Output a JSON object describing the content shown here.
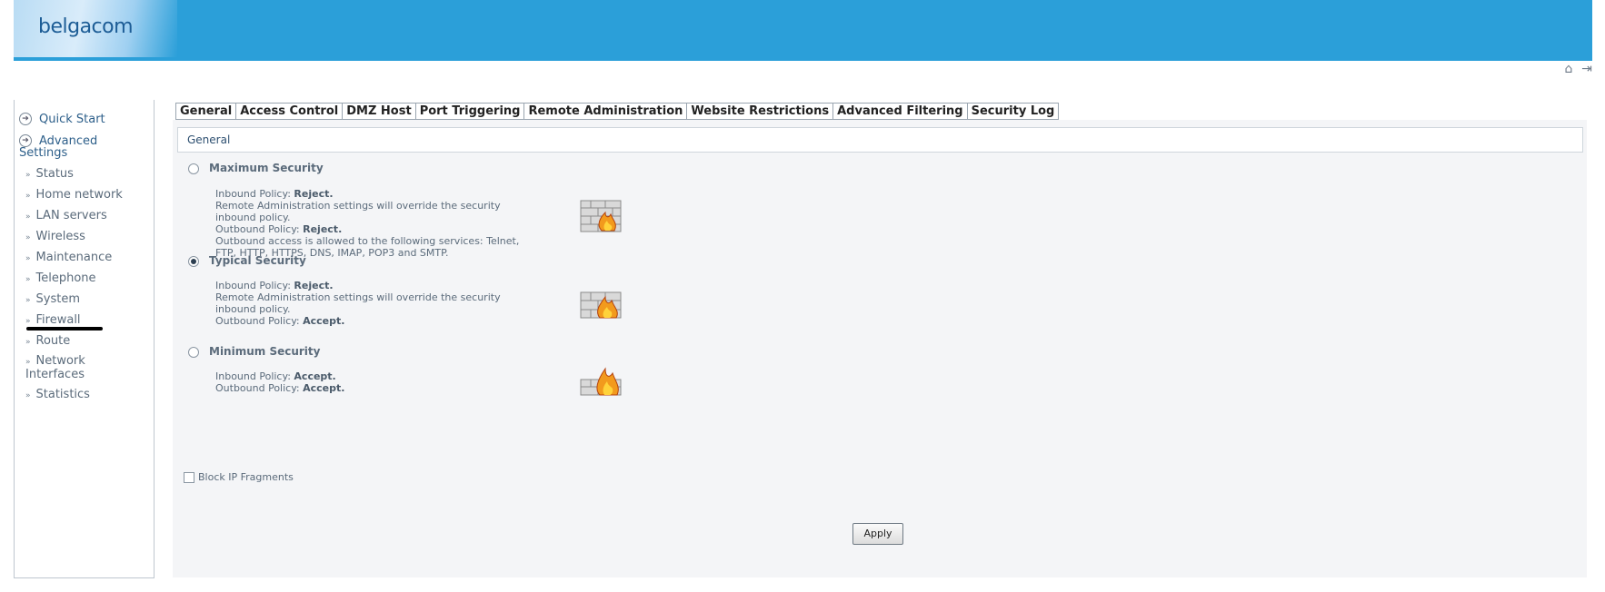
{
  "header": {
    "logo": "belgacom"
  },
  "top_icons": [
    "home-icon",
    "logout-icon"
  ],
  "sidebar": {
    "quick_start": "Quick Start",
    "advanced_settings_line1": "Advanced",
    "advanced_settings_line2": "Settings",
    "items": [
      {
        "label": "Status"
      },
      {
        "label": "Home network"
      },
      {
        "label": "LAN servers"
      },
      {
        "label": "Wireless"
      },
      {
        "label": "Maintenance"
      },
      {
        "label": "Telephone"
      },
      {
        "label": "System"
      },
      {
        "label": "Firewall"
      },
      {
        "label": "Route"
      },
      {
        "label": "Network"
      },
      {
        "label": "Statistics"
      }
    ],
    "network_interfaces_line2": "Interfaces"
  },
  "tabs": [
    "General",
    "Access Control",
    "DMZ Host",
    "Port Triggering",
    "Remote Administration",
    "Website Restrictions",
    "Advanced Filtering",
    "Security Log"
  ],
  "section_title": "General",
  "options": {
    "maximum": {
      "title": "Maximum Security",
      "selected": false,
      "inbound_label": "Inbound Policy:",
      "inbound_value": "Reject.",
      "remote_note": "Remote Administration settings will override the security inbound policy.",
      "outbound_label": "Outbound Policy:",
      "outbound_value": "Reject.",
      "outbound_note": "Outbound access is allowed to the following services: Telnet, FTP, HTTP, HTTPS, DNS, IMAP, POP3 and SMTP."
    },
    "typical": {
      "title": "Typical Security",
      "selected": true,
      "inbound_label": "Inbound Policy:",
      "inbound_value": "Reject.",
      "remote_note": "Remote Administration settings will override the security inbound policy.",
      "outbound_label": "Outbound Policy:",
      "outbound_value": "Accept."
    },
    "minimum": {
      "title": "Minimum Security",
      "selected": false,
      "inbound_label": "Inbound Policy:",
      "inbound_value": "Accept.",
      "outbound_label": "Outbound Policy:",
      "outbound_value": "Accept."
    }
  },
  "block_ip_fragments": {
    "label": "Block IP Fragments",
    "checked": false
  },
  "apply_label": "Apply",
  "colors": {
    "header": "#2b9fd9",
    "link": "#2d5f8a",
    "content_bg": "#f4f5f7"
  }
}
